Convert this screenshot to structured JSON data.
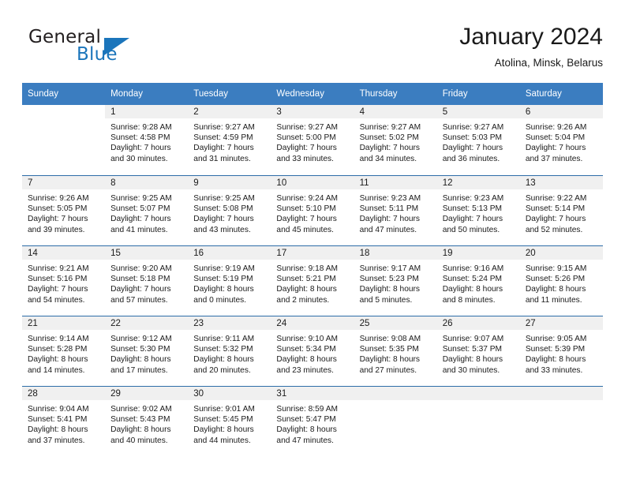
{
  "brand": {
    "name_part1": "General",
    "name_part2": "Blue",
    "accent_color": "#1b75bb"
  },
  "header": {
    "month_title": "January 2024",
    "location": "Atolina, Minsk, Belarus"
  },
  "theme": {
    "header_blue": "#3b7dc0",
    "row_divider_blue": "#2e6da8",
    "daynum_band_gray": "#f0f0f0"
  },
  "weekday_headers": [
    "Sunday",
    "Monday",
    "Tuesday",
    "Wednesday",
    "Thursday",
    "Friday",
    "Saturday"
  ],
  "weeks": [
    [
      {
        "day": "",
        "sunrise": "",
        "sunset": "",
        "daylight1": "",
        "daylight2": "",
        "empty": true
      },
      {
        "day": "1",
        "sunrise": "Sunrise: 9:28 AM",
        "sunset": "Sunset: 4:58 PM",
        "daylight1": "Daylight: 7 hours",
        "daylight2": "and 30 minutes."
      },
      {
        "day": "2",
        "sunrise": "Sunrise: 9:27 AM",
        "sunset": "Sunset: 4:59 PM",
        "daylight1": "Daylight: 7 hours",
        "daylight2": "and 31 minutes."
      },
      {
        "day": "3",
        "sunrise": "Sunrise: 9:27 AM",
        "sunset": "Sunset: 5:00 PM",
        "daylight1": "Daylight: 7 hours",
        "daylight2": "and 33 minutes."
      },
      {
        "day": "4",
        "sunrise": "Sunrise: 9:27 AM",
        "sunset": "Sunset: 5:02 PM",
        "daylight1": "Daylight: 7 hours",
        "daylight2": "and 34 minutes."
      },
      {
        "day": "5",
        "sunrise": "Sunrise: 9:27 AM",
        "sunset": "Sunset: 5:03 PM",
        "daylight1": "Daylight: 7 hours",
        "daylight2": "and 36 minutes."
      },
      {
        "day": "6",
        "sunrise": "Sunrise: 9:26 AM",
        "sunset": "Sunset: 5:04 PM",
        "daylight1": "Daylight: 7 hours",
        "daylight2": "and 37 minutes."
      }
    ],
    [
      {
        "day": "7",
        "sunrise": "Sunrise: 9:26 AM",
        "sunset": "Sunset: 5:05 PM",
        "daylight1": "Daylight: 7 hours",
        "daylight2": "and 39 minutes."
      },
      {
        "day": "8",
        "sunrise": "Sunrise: 9:25 AM",
        "sunset": "Sunset: 5:07 PM",
        "daylight1": "Daylight: 7 hours",
        "daylight2": "and 41 minutes."
      },
      {
        "day": "9",
        "sunrise": "Sunrise: 9:25 AM",
        "sunset": "Sunset: 5:08 PM",
        "daylight1": "Daylight: 7 hours",
        "daylight2": "and 43 minutes."
      },
      {
        "day": "10",
        "sunrise": "Sunrise: 9:24 AM",
        "sunset": "Sunset: 5:10 PM",
        "daylight1": "Daylight: 7 hours",
        "daylight2": "and 45 minutes."
      },
      {
        "day": "11",
        "sunrise": "Sunrise: 9:23 AM",
        "sunset": "Sunset: 5:11 PM",
        "daylight1": "Daylight: 7 hours",
        "daylight2": "and 47 minutes."
      },
      {
        "day": "12",
        "sunrise": "Sunrise: 9:23 AM",
        "sunset": "Sunset: 5:13 PM",
        "daylight1": "Daylight: 7 hours",
        "daylight2": "and 50 minutes."
      },
      {
        "day": "13",
        "sunrise": "Sunrise: 9:22 AM",
        "sunset": "Sunset: 5:14 PM",
        "daylight1": "Daylight: 7 hours",
        "daylight2": "and 52 minutes."
      }
    ],
    [
      {
        "day": "14",
        "sunrise": "Sunrise: 9:21 AM",
        "sunset": "Sunset: 5:16 PM",
        "daylight1": "Daylight: 7 hours",
        "daylight2": "and 54 minutes."
      },
      {
        "day": "15",
        "sunrise": "Sunrise: 9:20 AM",
        "sunset": "Sunset: 5:18 PM",
        "daylight1": "Daylight: 7 hours",
        "daylight2": "and 57 minutes."
      },
      {
        "day": "16",
        "sunrise": "Sunrise: 9:19 AM",
        "sunset": "Sunset: 5:19 PM",
        "daylight1": "Daylight: 8 hours",
        "daylight2": "and 0 minutes."
      },
      {
        "day": "17",
        "sunrise": "Sunrise: 9:18 AM",
        "sunset": "Sunset: 5:21 PM",
        "daylight1": "Daylight: 8 hours",
        "daylight2": "and 2 minutes."
      },
      {
        "day": "18",
        "sunrise": "Sunrise: 9:17 AM",
        "sunset": "Sunset: 5:23 PM",
        "daylight1": "Daylight: 8 hours",
        "daylight2": "and 5 minutes."
      },
      {
        "day": "19",
        "sunrise": "Sunrise: 9:16 AM",
        "sunset": "Sunset: 5:24 PM",
        "daylight1": "Daylight: 8 hours",
        "daylight2": "and 8 minutes."
      },
      {
        "day": "20",
        "sunrise": "Sunrise: 9:15 AM",
        "sunset": "Sunset: 5:26 PM",
        "daylight1": "Daylight: 8 hours",
        "daylight2": "and 11 minutes."
      }
    ],
    [
      {
        "day": "21",
        "sunrise": "Sunrise: 9:14 AM",
        "sunset": "Sunset: 5:28 PM",
        "daylight1": "Daylight: 8 hours",
        "daylight2": "and 14 minutes."
      },
      {
        "day": "22",
        "sunrise": "Sunrise: 9:12 AM",
        "sunset": "Sunset: 5:30 PM",
        "daylight1": "Daylight: 8 hours",
        "daylight2": "and 17 minutes."
      },
      {
        "day": "23",
        "sunrise": "Sunrise: 9:11 AM",
        "sunset": "Sunset: 5:32 PM",
        "daylight1": "Daylight: 8 hours",
        "daylight2": "and 20 minutes."
      },
      {
        "day": "24",
        "sunrise": "Sunrise: 9:10 AM",
        "sunset": "Sunset: 5:34 PM",
        "daylight1": "Daylight: 8 hours",
        "daylight2": "and 23 minutes."
      },
      {
        "day": "25",
        "sunrise": "Sunrise: 9:08 AM",
        "sunset": "Sunset: 5:35 PM",
        "daylight1": "Daylight: 8 hours",
        "daylight2": "and 27 minutes."
      },
      {
        "day": "26",
        "sunrise": "Sunrise: 9:07 AM",
        "sunset": "Sunset: 5:37 PM",
        "daylight1": "Daylight: 8 hours",
        "daylight2": "and 30 minutes."
      },
      {
        "day": "27",
        "sunrise": "Sunrise: 9:05 AM",
        "sunset": "Sunset: 5:39 PM",
        "daylight1": "Daylight: 8 hours",
        "daylight2": "and 33 minutes."
      }
    ],
    [
      {
        "day": "28",
        "sunrise": "Sunrise: 9:04 AM",
        "sunset": "Sunset: 5:41 PM",
        "daylight1": "Daylight: 8 hours",
        "daylight2": "and 37 minutes."
      },
      {
        "day": "29",
        "sunrise": "Sunrise: 9:02 AM",
        "sunset": "Sunset: 5:43 PM",
        "daylight1": "Daylight: 8 hours",
        "daylight2": "and 40 minutes."
      },
      {
        "day": "30",
        "sunrise": "Sunrise: 9:01 AM",
        "sunset": "Sunset: 5:45 PM",
        "daylight1": "Daylight: 8 hours",
        "daylight2": "and 44 minutes."
      },
      {
        "day": "31",
        "sunrise": "Sunrise: 8:59 AM",
        "sunset": "Sunset: 5:47 PM",
        "daylight1": "Daylight: 8 hours",
        "daylight2": "and 47 minutes."
      },
      {
        "day": "",
        "sunrise": "",
        "sunset": "",
        "daylight1": "",
        "daylight2": "",
        "emptygray": true
      },
      {
        "day": "",
        "sunrise": "",
        "sunset": "",
        "daylight1": "",
        "daylight2": "",
        "emptygray": true
      },
      {
        "day": "",
        "sunrise": "",
        "sunset": "",
        "daylight1": "",
        "daylight2": "",
        "emptygray": true
      }
    ]
  ]
}
